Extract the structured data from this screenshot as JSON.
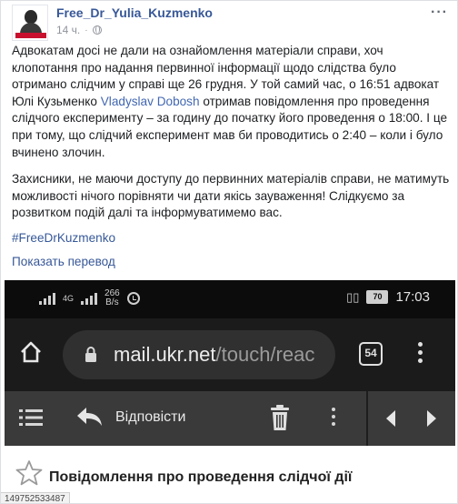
{
  "post": {
    "author": "Free_Dr_Yulia_Kuzmenko",
    "time": "14 ч.",
    "more_label": "···",
    "paragraph1_a": "Адвокатам досі не дали на ознайомлення матеріали справи, хоч клопотання про надання первинної інформації щодо слідства було отримано слідчим у справі ще 26 грудня. У той самий час, о 16:51 адвокат Юлі Кузьменко ",
    "mention": "Vladyslav Dobosh",
    "paragraph1_b": " отримав повідомлення про проведення слідчого експерименту – за годину до початку його проведення о 18:00. І це при тому, що слідчий експеримент мав би проводитись о 2:40 – коли і було вчинено злочин.",
    "paragraph2": "Захисники, не маючи доступу до первинних матеріалів справи, не матимуть можливості нічого порівняти чи дати якісь зауваження! Слідкуємо за розвитком подій далі та інформуватимемо вас.",
    "hashtag": "#FreeDrKuzmenko",
    "translate_link": "Показать перевод",
    "photo_id": "149752533487"
  },
  "screenshot": {
    "status": {
      "network": "4G",
      "speed_value": "266",
      "speed_unit": "B/s",
      "battery": "70",
      "time": "17:03"
    },
    "browser": {
      "url_host": "mail.ukr.net",
      "url_path": "/touch/reac",
      "tabs_count": "54"
    },
    "mail": {
      "reply_label": "Відповісти",
      "subject": "Повідомлення про проведення слідчої дії"
    }
  },
  "colors": {
    "link": "#385898",
    "statusbar": "#0c0c0c",
    "browserbar": "#1b1b1b",
    "mail_toolbar": "#3a3a3a"
  },
  "icons": [
    "globe-icon",
    "home-icon",
    "lock-icon",
    "list-icon",
    "reply-icon",
    "trash-icon",
    "kebab-icon",
    "prev-icon",
    "next-icon",
    "star-icon",
    "alarm-icon",
    "vibrate-icon",
    "battery-icon",
    "signal-icon"
  ]
}
